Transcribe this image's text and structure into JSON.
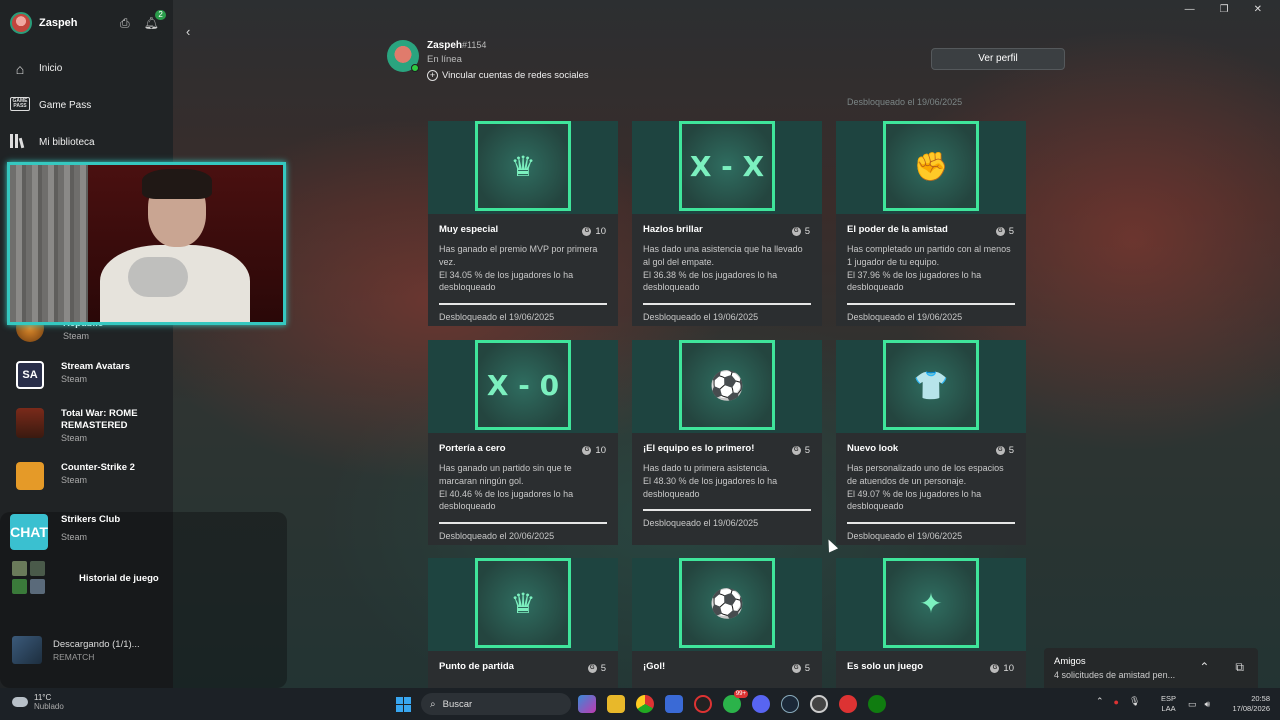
{
  "sidebar": {
    "user_name": "Zaspeh",
    "notification_count": "2",
    "nav": [
      {
        "label": "Inicio",
        "icon": "home-icon"
      },
      {
        "label": "Game Pass",
        "icon": "game-pass-icon",
        "icon_text": "GAME PASS"
      },
      {
        "label": "Mi biblioteca",
        "icon": "library-icon"
      }
    ],
    "games": [
      {
        "title": "Republic",
        "platform": "Steam"
      },
      {
        "title": "Stream Avatars",
        "platform": "Steam"
      },
      {
        "title": "Total War: ROME REMASTERED",
        "platform": "Steam"
      },
      {
        "title": "Counter-Strike 2",
        "platform": "Steam"
      },
      {
        "title": "Strikers Club",
        "platform": "Steam"
      }
    ],
    "history_label": "Historial de juego",
    "download": {
      "title": "Descargando (1/1)...",
      "subtitle": "REMATCH"
    }
  },
  "profile": {
    "name": "Zaspeh",
    "tag": "#1154",
    "status": "En línea",
    "link_label": "Vincular cuentas de redes sociales",
    "view_profile": "Ver perfil"
  },
  "top_partial": {
    "date3": "Desbloqueado el 19/06/2025"
  },
  "achievements": [
    {
      "title": "Muy especial",
      "score": "10",
      "badge": "♛",
      "desc": "Has ganado el premio MVP por primera vez.",
      "pct": "El 34.05 % de los jugadores lo ha desbloqueado",
      "date": "Desbloqueado el 19/06/2025"
    },
    {
      "title": "Hazlos brillar",
      "score": "5",
      "badge": "X - X",
      "desc": "Has dado una asistencia que ha llevado al gol del empate.",
      "pct": "El 36.38 % de los jugadores lo ha desbloqueado",
      "date": "Desbloqueado el 19/06/2025"
    },
    {
      "title": "El poder de la amistad",
      "score": "5",
      "badge": "✊",
      "desc": "Has completado un partido con al menos 1 jugador de tu equipo.",
      "pct": "El 37.96 % de los jugadores lo ha desbloqueado",
      "date": "Desbloqueado el 19/06/2025"
    },
    {
      "title": "Portería a cero",
      "score": "10",
      "badge": "X - 0",
      "desc": "Has ganado un partido sin que te marcaran ningún gol.",
      "pct": "El 40.46 % de los jugadores lo ha desbloqueado",
      "date": "Desbloqueado el 20/06/2025"
    },
    {
      "title": "¡El equipo es lo primero!",
      "score": "5",
      "badge": "⚽",
      "desc": "Has dado tu primera asistencia.",
      "pct": "El 48.30 % de los jugadores lo ha desbloqueado",
      "date": "Desbloqueado el 19/06/2025"
    },
    {
      "title": "Nuevo look",
      "score": "5",
      "badge": "👕",
      "desc": "Has personalizado uno de los espacios de atuendos de un personaje.",
      "pct": "El 49.07 % de los jugadores lo ha desbloqueado",
      "date": "Desbloqueado el 19/06/2025"
    },
    {
      "title": "Punto de partida",
      "score": "5",
      "badge": "♛"
    },
    {
      "title": "¡Gol!",
      "score": "5",
      "badge": "⚽"
    },
    {
      "title": "Es solo un juego",
      "score": "10",
      "badge": "✦"
    }
  ],
  "toast": {
    "title": "Amigos",
    "subtitle": "4 solicitudes de amistad pen..."
  },
  "taskbar": {
    "weather_temp": "11°C",
    "weather_desc": "Nublado",
    "search_placeholder": "Buscar",
    "whatsapp_badge": "99+",
    "lang_top": "ESP",
    "lang_bottom": "LAA",
    "time": "20:58",
    "date": "17/08/2026"
  },
  "colors": {
    "accent": "#3fe59b",
    "webcam_border": "#35c8c0",
    "sidebar": "#202325",
    "card": "#2b2e30"
  }
}
